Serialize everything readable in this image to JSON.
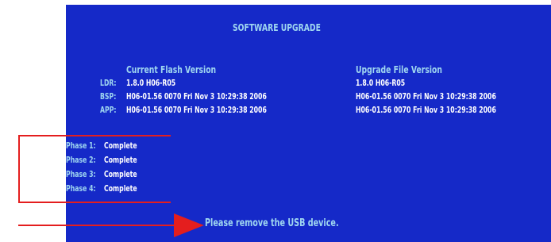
{
  "screen": {
    "title": "SOFTWARE UPGRADE",
    "current_header": "Current Flash Version",
    "upgrade_header": "Upgrade File Version",
    "versions": [
      {
        "label": "LDR:",
        "current": "1.8.0 H06-R05",
        "upgrade": "1.8.0 H06-R05"
      },
      {
        "label": "BSP:",
        "current": "H06-01.56  0070 Fri Nov  3 10:29:38 2006",
        "upgrade": "H06-01.56  0070 Fri Nov  3 10:29:38 2006"
      },
      {
        "label": "APP:",
        "current": "H06-01.56  0070 Fri Nov  3 10:29:38 2006",
        "upgrade": "H06-01.56  0070 Fri Nov  3 10:29:38 2006"
      }
    ],
    "phases": [
      {
        "label": "Phase 1:",
        "status": "Complete"
      },
      {
        "label": "Phase 2:",
        "status": "Complete"
      },
      {
        "label": "Phase 3:",
        "status": "Complete"
      },
      {
        "label": "Phase 4:",
        "status": "Complete"
      }
    ],
    "message": "Please remove the USB device."
  },
  "colors": {
    "background": "#1529c8",
    "label_text": "#9fd6f0",
    "value_text": "#ffffff",
    "annotation": "#e41e1e"
  }
}
